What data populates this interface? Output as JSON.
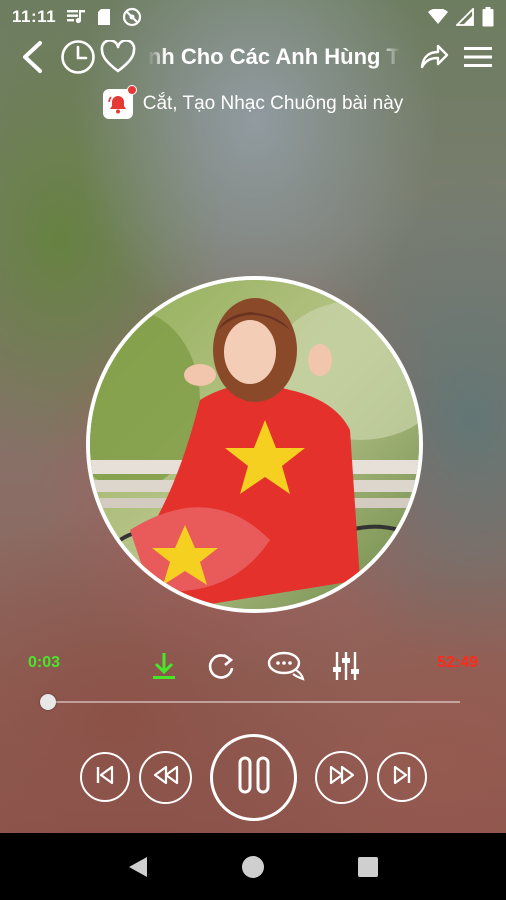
{
  "status_bar": {
    "time": "11:11",
    "left_icons": [
      "music-note-icon",
      "sd-card-icon",
      "no-disturb-icon"
    ],
    "right_icons": [
      "wifi-icon",
      "signal-icon",
      "battery-icon"
    ]
  },
  "header": {
    "song_title": "Dành Cho Các Anh Hùng T",
    "icons": [
      "back-arrow-icon",
      "history-clock-icon",
      "heart-icon",
      "share-icon",
      "hamburger-menu-icon"
    ]
  },
  "ringtone": {
    "label": "Cắt, Tạo Nhạc Chuông bài này",
    "icon": "ringtone-bell-icon"
  },
  "player": {
    "time_elapsed": "0:03",
    "time_total": "52:49",
    "progress": 0.001,
    "elapsed_color": "#47e62b",
    "total_color": "#ff2a1a",
    "download_color": "#47e62b",
    "actions": [
      "download-icon",
      "repeat-icon",
      "comments-icon",
      "equalizer-icon"
    ],
    "controls": [
      "skip-previous-icon",
      "rewind-icon",
      "pause-icon",
      "fast-forward-icon",
      "skip-next-icon"
    ]
  },
  "nav_bar": {
    "buttons": [
      "back-triangle-icon",
      "home-circle-icon",
      "recents-square-icon"
    ]
  }
}
